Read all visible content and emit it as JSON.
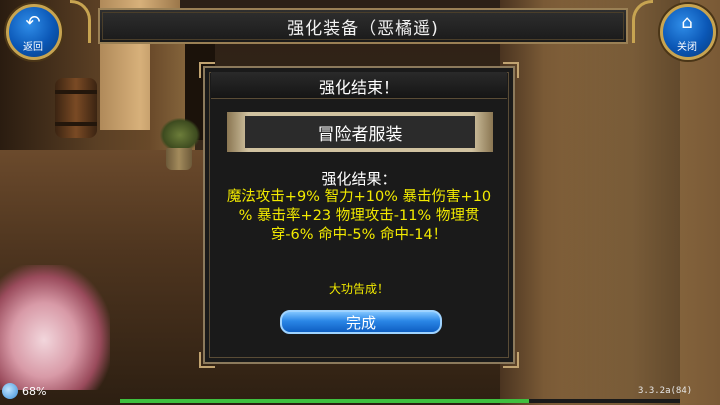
{
  "header": {
    "title": "强化装备（恶橘遥)"
  },
  "nav": {
    "back_label": "返回",
    "close_label": "关闭",
    "back_icon": "back-arrow-icon",
    "close_icon": "home-icon"
  },
  "dialog": {
    "title": "强化结束！",
    "item_name": "冒险者服装",
    "result_heading": "强化结果：",
    "result_lines": [
      "魔法攻击+9% 智力+10% 暴击伤害+10",
      "% 暴击率+23 物理攻击-11% 物理贯",
      "穿-6% 命中-5% 命中-14！"
    ],
    "success_text": "大功告成！",
    "confirm_label": "完成"
  },
  "status": {
    "battery_percent": "68%",
    "version": "3.3.2a(84)",
    "xp_fraction": 0.73
  },
  "colors": {
    "result_text": "#f2ea00",
    "button_blue": "#2a86e6",
    "frame_gold": "#c7a451",
    "panel_bg": "#1a1a1a"
  }
}
